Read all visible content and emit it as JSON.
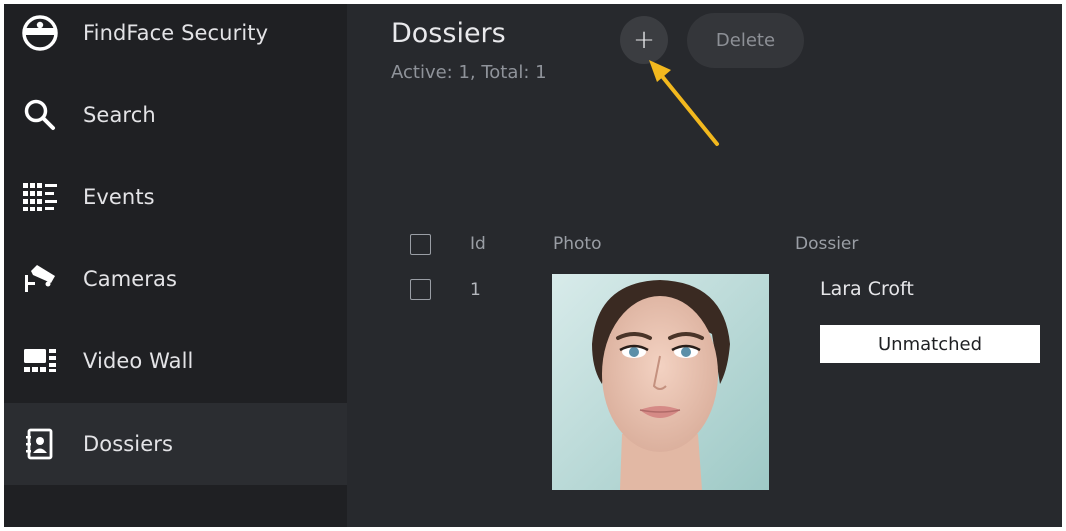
{
  "sidebar": {
    "app_title": "FindFace Security",
    "items": [
      {
        "id": "search",
        "label": "Search",
        "icon": "search-icon"
      },
      {
        "id": "events",
        "label": "Events",
        "icon": "events-grid-icon"
      },
      {
        "id": "cameras",
        "label": "Cameras",
        "icon": "camera-icon"
      },
      {
        "id": "video-wall",
        "label": "Video Wall",
        "icon": "video-wall-icon"
      },
      {
        "id": "dossiers",
        "label": "Dossiers",
        "icon": "dossier-icon",
        "active": true
      }
    ]
  },
  "header": {
    "title": "Dossiers",
    "counts": "Active: 1, Total: 1",
    "add_label": "+",
    "delete_label": "Delete"
  },
  "table": {
    "columns": [
      "Id",
      "Photo",
      "Dossier"
    ],
    "rows": [
      {
        "id": "1",
        "name": "Lara Croft",
        "status": "Unmatched"
      }
    ]
  },
  "colors": {
    "background": "#27292d",
    "sidebar": "#1f2023",
    "active_item": "#2b2d31",
    "arrow": "#f2b81e",
    "badge": "#ffffff"
  }
}
